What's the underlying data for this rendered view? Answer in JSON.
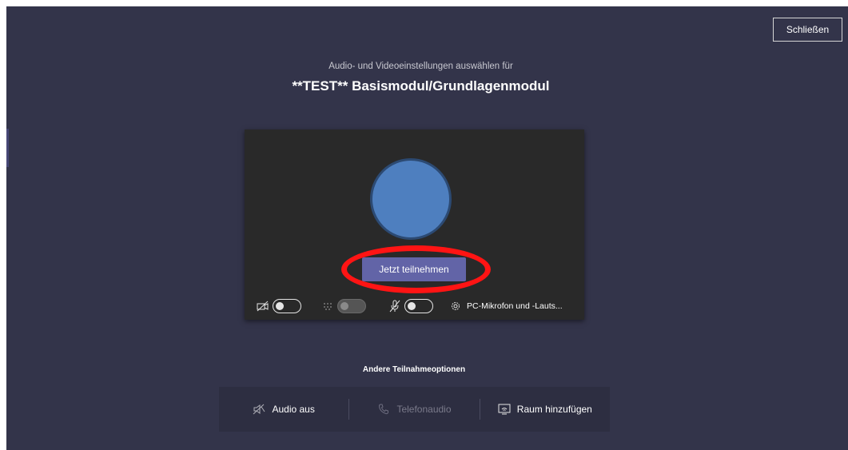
{
  "header": {
    "close_label": "Schließen",
    "subtitle": "Audio- und Videoeinstellungen auswählen für",
    "meeting_title": "**TEST** Basismodul/Grundlagenmodul"
  },
  "preview": {
    "join_label": "Jetzt teilnehmen",
    "controls": {
      "camera": {
        "icon": "camera-off-icon",
        "state": "off"
      },
      "background_blur": {
        "icon": "blur-icon",
        "state": "disabled"
      },
      "microphone": {
        "icon": "mic-off-icon",
        "state": "off"
      },
      "device_label": "PC-Mikrofon und -Lauts..."
    }
  },
  "other_options": {
    "title": "Andere Teilnahmeoptionen",
    "items": [
      {
        "label": "Audio aus",
        "icon": "speaker-off-icon",
        "enabled": true
      },
      {
        "label": "Telefonaudio",
        "icon": "phone-icon",
        "enabled": false
      },
      {
        "label": "Raum hinzufügen",
        "icon": "room-cast-icon",
        "enabled": true
      }
    ]
  },
  "colors": {
    "background": "#33344a",
    "preview_bg": "#292929",
    "accent": "#6264a7",
    "avatar": "#4e7fbf",
    "annotation": "#ff1414"
  }
}
